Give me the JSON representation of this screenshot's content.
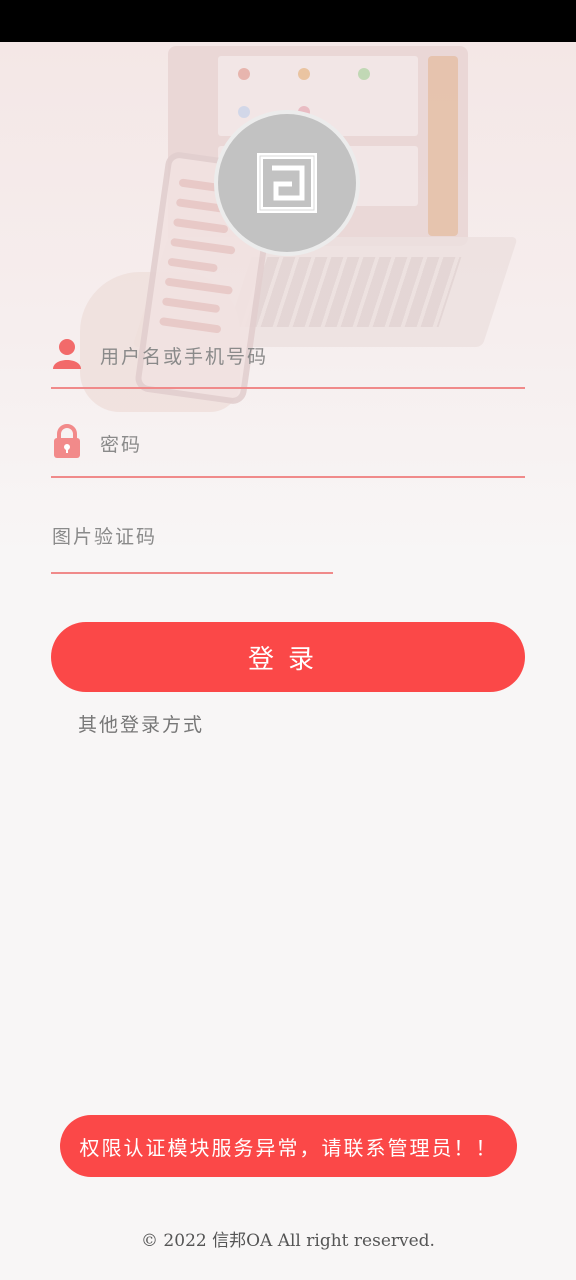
{
  "login": {
    "username_placeholder": "用户名或手机号码",
    "password_placeholder": "密码",
    "captcha_placeholder": "图片验证码",
    "login_button": "登录",
    "other_login": "其他登录方式"
  },
  "toast": {
    "message": "权限认证模块服务异常，请联系管理员！！"
  },
  "footer": {
    "copyright": "© 2022 信邦OA All right reserved."
  },
  "colors": {
    "accent": "#fb4848",
    "underline": "#f08a8a",
    "icon": "#f26a6a"
  },
  "icons": {
    "user": "user-icon",
    "lock": "lock-icon",
    "logo": "app-logo-icon"
  }
}
